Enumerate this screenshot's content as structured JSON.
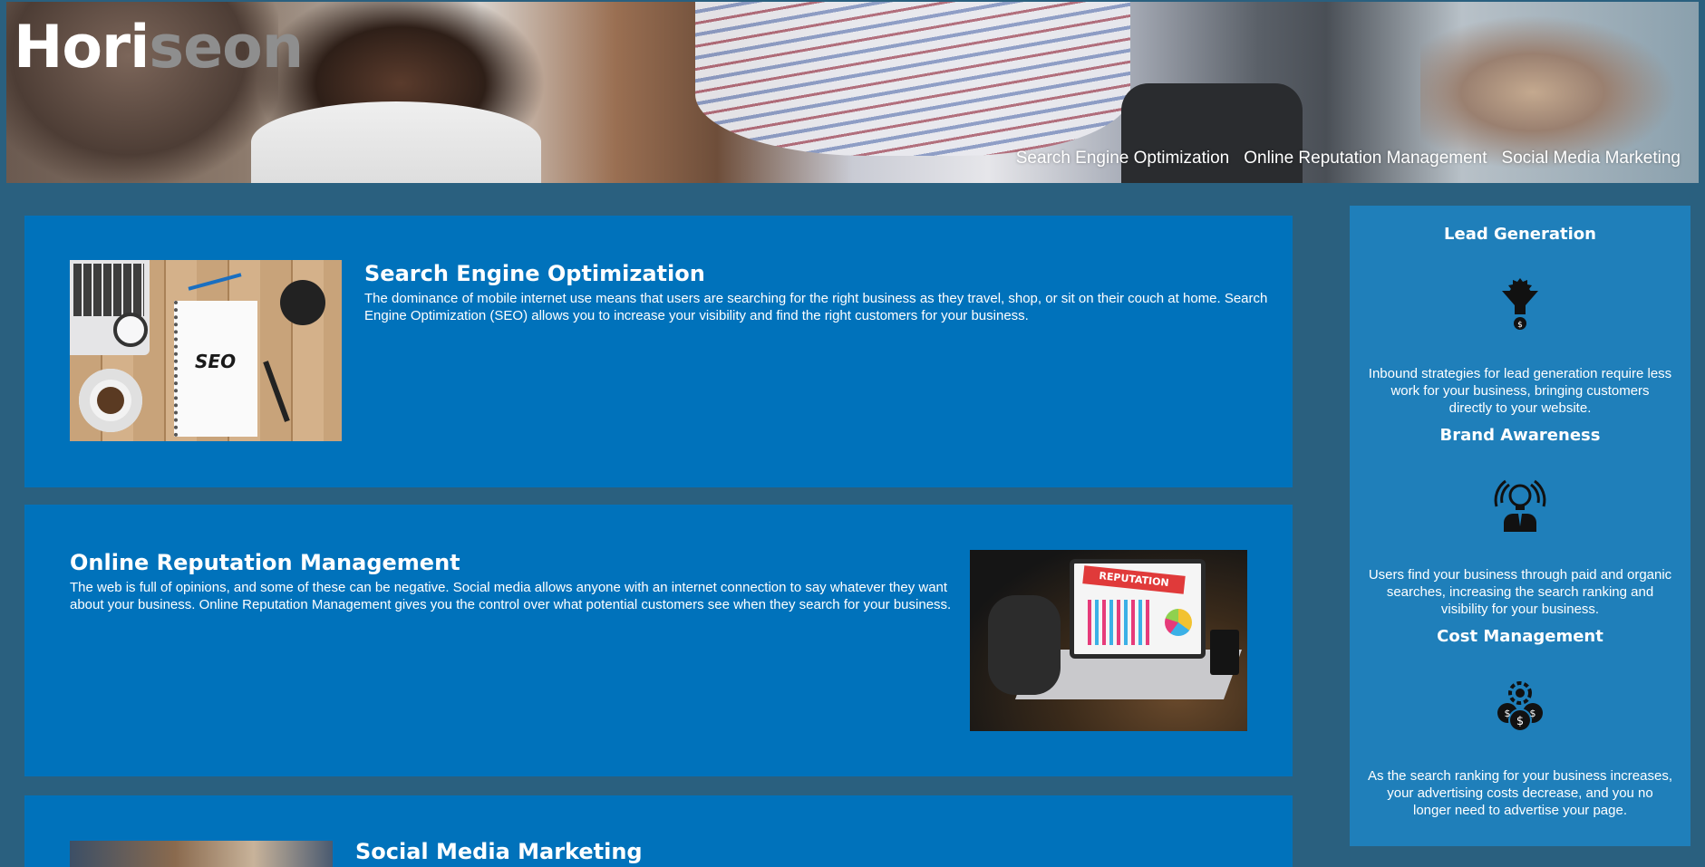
{
  "header": {
    "logo_part1": "Hori",
    "logo_part2": "seon",
    "nav": [
      {
        "label": "Search Engine Optimization"
      },
      {
        "label": "Online Reputation Management"
      },
      {
        "label": "Social Media Marketing"
      }
    ]
  },
  "sections": {
    "seo": {
      "title": "Search Engine Optimization",
      "text": "The dominance of mobile internet use means that users are searching for the right business as they travel, shop, or sit on their couch at home. Search Engine Optimization (SEO) allows you to increase your visibility and find the right customers for your business.",
      "image_word": "SEO"
    },
    "orm": {
      "title": "Online Reputation Management",
      "text": "The web is full of opinions, and some of these can be negative. Social media allows anyone with an internet connection to say whatever they want about your business. Online Reputation Management gives you the control over what potential customers see when they search for your business.",
      "image_banner": "REPUTATION"
    },
    "smm": {
      "title": "Social Media Marketing"
    }
  },
  "benefits": {
    "lead": {
      "title": "Lead Generation",
      "icon": "lead-generation-funnel-icon",
      "text": "Inbound strategies for lead generation require less work for your business, bringing customers directly to your website."
    },
    "brand": {
      "title": "Brand Awareness",
      "icon": "brand-awareness-bulb-icon",
      "text": "Users find your business through paid and organic searches, increasing the search ranking and visibility for your business."
    },
    "cost": {
      "title": "Cost Management",
      "icon": "cost-management-coins-icon",
      "text": "As the search ranking for your business increases, your advertising costs decrease, and you no longer need to advertise your page."
    }
  },
  "colors": {
    "page_background": "#2a607f",
    "section_background": "#0072bb",
    "aside_background": "#1f7fba",
    "logo_accent": "#8e8e8e"
  }
}
